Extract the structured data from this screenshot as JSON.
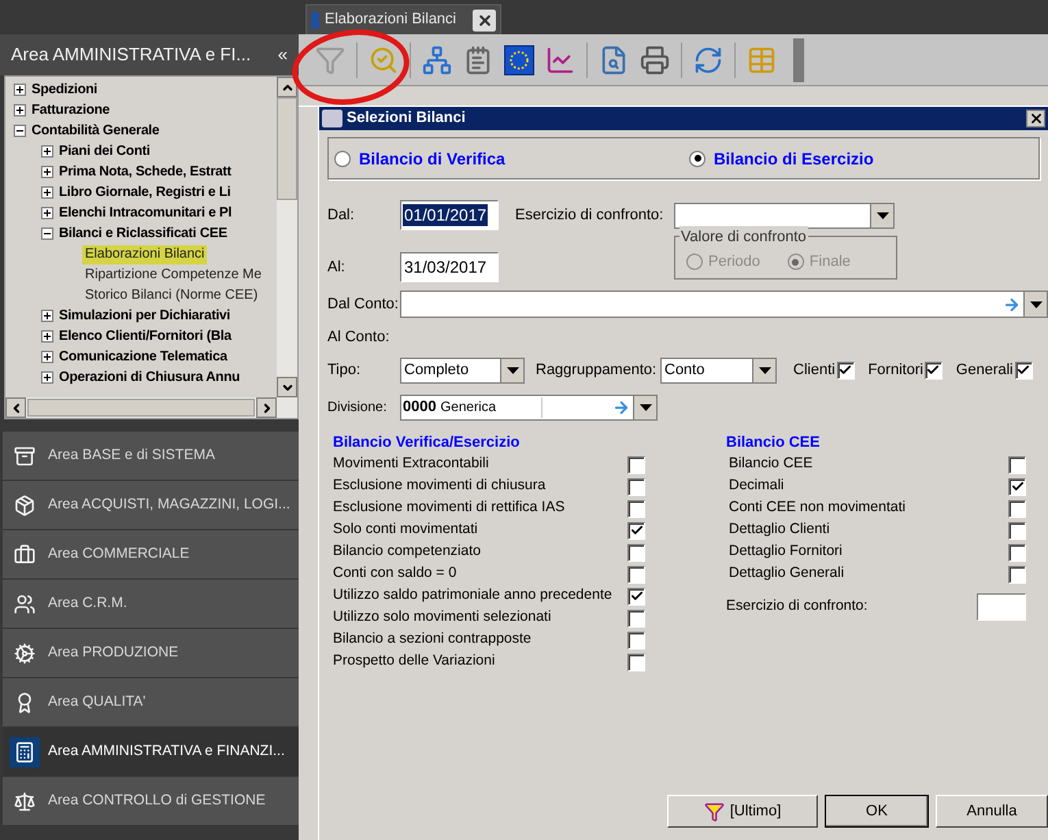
{
  "document_tab": {
    "title": "Elaborazioni Bilanci"
  },
  "area_panel": {
    "title": "Area AMMINISTRATIVA e FI...",
    "collapse": "«"
  },
  "tree": [
    {
      "label": "Spedizioni",
      "expanded": false
    },
    {
      "label": "Fatturazione",
      "expanded": false
    },
    {
      "label": "Contabilità Generale",
      "expanded": true,
      "children": [
        {
          "label": "Piani dei Conti",
          "expanded": false
        },
        {
          "label": "Prima Nota, Schede, Estratt",
          "expanded": false
        },
        {
          "label": "Libro Giornale, Registri e Li",
          "expanded": false
        },
        {
          "label": "Elenchi Intracomunitari e Pl",
          "expanded": false
        },
        {
          "label": "Bilanci e Riclassificati CEE",
          "expanded": true,
          "children": [
            {
              "label": "Elaborazioni Bilanci",
              "selected": true
            },
            {
              "label": "Ripartizione Competenze Me",
              "selected": false
            },
            {
              "label": "Storico Bilanci (Norme CEE)",
              "selected": false
            }
          ]
        },
        {
          "label": "Simulazioni per Dichiarativi",
          "expanded": false
        },
        {
          "label": "Elenco Clienti/Fornitori (Bla",
          "expanded": false
        },
        {
          "label": "Comunicazione Telematica",
          "expanded": false
        },
        {
          "label": "Operazioni di Chiusura Annu",
          "expanded": false
        }
      ]
    }
  ],
  "areas": [
    {
      "label": "Area BASE e di SISTEMA",
      "selected": false
    },
    {
      "label": "Area ACQUISTI, MAGAZZINI, LOGI...",
      "selected": false
    },
    {
      "label": "Area COMMERCIALE",
      "selected": false
    },
    {
      "label": "Area C.R.M.",
      "selected": false
    },
    {
      "label": "Area PRODUZIONE",
      "selected": false
    },
    {
      "label": "Area QUALITA'",
      "selected": false
    },
    {
      "label": "Area AMMINISTRATIVA e FINANZI...",
      "selected": true
    },
    {
      "label": "Area CONTROLLO di GESTIONE",
      "selected": false
    }
  ],
  "dialog": {
    "title": "Selezioni Bilanci",
    "report_types": [
      {
        "label": "Bilancio di Verifica",
        "selected": false
      },
      {
        "label": "Bilancio di Esercizio",
        "selected": true
      }
    ],
    "dal": {
      "label": "Dal:",
      "value": "01/01/2017"
    },
    "al": {
      "label": "Al:",
      "value": "31/03/2017"
    },
    "esercizio_confronto": {
      "label": "Esercizio di confronto:"
    },
    "valore_confronto": {
      "title": "Valore di confronto",
      "options": [
        {
          "label": "Periodo",
          "selected": false
        },
        {
          "label": "Finale",
          "selected": true
        }
      ]
    },
    "dal_conto": {
      "label": "Dal Conto:"
    },
    "al_conto": {
      "label": "Al Conto:"
    },
    "tipo": {
      "label": "Tipo:",
      "value": "Completo"
    },
    "raggruppamento": {
      "label": "Raggruppamento:",
      "value": "Conto"
    },
    "account_types": [
      {
        "label": "Clienti",
        "checked": true
      },
      {
        "label": "Fornitori",
        "checked": true
      },
      {
        "label": "Generali",
        "checked": true
      }
    ],
    "divisione": {
      "label": "Divisione:",
      "code": "0000",
      "value": "Generica"
    },
    "verifica_section": {
      "title": "Bilancio Verifica/Esercizio",
      "options": [
        {
          "label": "Movimenti Extracontabili",
          "checked": false
        },
        {
          "label": "Esclusione movimenti di chiusura",
          "checked": false
        },
        {
          "label": "Esclusione movimenti di rettifica IAS",
          "checked": false
        },
        {
          "label": "Solo conti movimentati",
          "checked": true
        },
        {
          "label": "Bilancio competenziato",
          "checked": false
        },
        {
          "label": "Conti con saldo = 0",
          "checked": false
        },
        {
          "label": "Utilizzo saldo patrimoniale anno precedente",
          "checked": true
        },
        {
          "label": "Utilizzo solo movimenti selezionati",
          "checked": false
        },
        {
          "label": "Bilancio a sezioni contrapposte",
          "checked": false
        },
        {
          "label": "Prospetto delle Variazioni",
          "checked": false
        }
      ]
    },
    "cee_section": {
      "title": "Bilancio CEE",
      "options": [
        {
          "label": "Bilancio CEE",
          "checked": false
        },
        {
          "label": "Decimali",
          "checked": true
        },
        {
          "label": "Conti CEE non movimentati",
          "checked": false
        },
        {
          "label": "Dettaglio Clienti",
          "checked": false
        },
        {
          "label": "Dettaglio Fornitori",
          "checked": false
        },
        {
          "label": "Dettaglio Generali",
          "checked": false
        }
      ],
      "confronto_label": "Esercizio di confronto:"
    },
    "buttons": [
      {
        "label": "[Ultimo]",
        "kind": "filter"
      },
      {
        "label": "OK",
        "kind": "default"
      },
      {
        "label": "Annulla",
        "kind": "plain"
      }
    ]
  }
}
